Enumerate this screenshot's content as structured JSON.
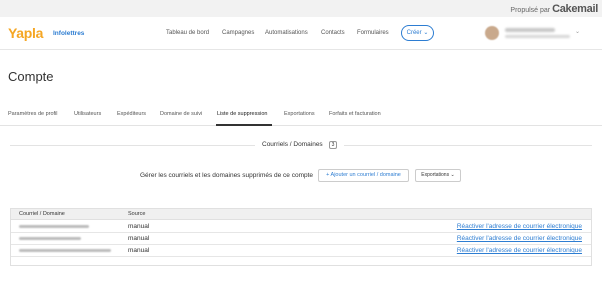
{
  "topbar": {
    "powered_prefix": "Propulsé par",
    "powered_brand": "Cakemail"
  },
  "nav": {
    "logo": "Yapla",
    "account": "Infolettres",
    "menu": [
      "Tableau de bord",
      "Campagnes",
      "Automatisations",
      "Contacts",
      "Formulaires"
    ],
    "create_label": "Créer",
    "create_chevron": "⌄",
    "user_chevron": "⌄"
  },
  "page": {
    "title": "Compte"
  },
  "tabs": [
    "Paramètres de profil",
    "Utilisateurs",
    "Expéditeurs",
    "Domaine de suivi",
    "Liste de suppression",
    "Exportations",
    "Forfaits et facturation"
  ],
  "active_tab_index": 4,
  "section": {
    "title": "Courriels / Domaines",
    "count": "3"
  },
  "toolbar": {
    "description": "Gérer les courriels et les domaines supprimés de ce compte",
    "add_label": "+ Ajouter un courriel / domaine",
    "export_label": "Exportations",
    "export_chevron": "⌄"
  },
  "table": {
    "headers": [
      "Courriel / Domaine",
      "Source"
    ],
    "rows": [
      {
        "source": "manual",
        "action": "Réactiver l'adresse de courrier électronique"
      },
      {
        "source": "manual",
        "action": "Réactiver l'adresse de courrier électronique"
      },
      {
        "source": "manual",
        "action": "Réactiver l'adresse de courrier électronique"
      }
    ]
  },
  "colors": {
    "brand": "#f5a623",
    "link": "#2d7dd2",
    "text": "#333333"
  }
}
